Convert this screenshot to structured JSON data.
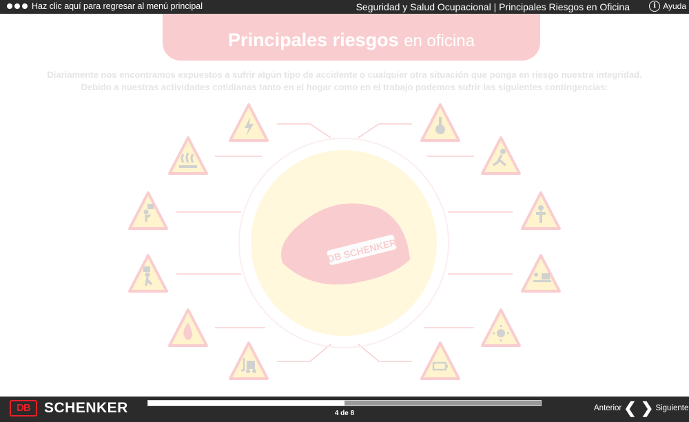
{
  "topbar": {
    "back_link": "Haz clic aquí para regresar al menú principal",
    "course_title": "Seguridad y Salud Ocupacional | Principales Riesgos en Oficina",
    "help_label": "Ayuda",
    "help_icon": "info-icon"
  },
  "content": {
    "title_bold": "Principales riesgos",
    "title_light": "en oficina",
    "intro_line1": "Diariamente nos encontramos expuestos a sufrir algún tipo de accidente o cualquier otra situación que ponga en riesgo nuestra integridad.",
    "intro_line2": "Debido a nuestras actividades cotidianas tanto en el hogar como en el trabajo podemos sufrir las siguientes contingencias:",
    "helmet_brand": "DB SCHENKER",
    "hazards": [
      {
        "icon": "electric-hazard-icon"
      },
      {
        "icon": "hand-hazard-icon"
      },
      {
        "icon": "hot-surface-icon"
      },
      {
        "icon": "slip-fall-icon"
      },
      {
        "icon": "falling-object-icon"
      },
      {
        "icon": "posture-icon"
      },
      {
        "icon": "lifting-icon"
      },
      {
        "icon": "desk-ergonomics-icon"
      },
      {
        "icon": "fire-icon"
      },
      {
        "icon": "sun-heat-icon"
      },
      {
        "icon": "forklift-icon"
      },
      {
        "icon": "battery-icon"
      }
    ]
  },
  "bottombar": {
    "logo_db": "DB",
    "logo_text": "SCHENKER",
    "page_indicator": "4 de 8",
    "progress": 0.5,
    "prev_label": "Anterior",
    "next_label": "Siguiente"
  },
  "colors": {
    "bar": "#2b2b2b",
    "brand_red": "#e8202a",
    "warning_yellow": "#ffe066"
  }
}
